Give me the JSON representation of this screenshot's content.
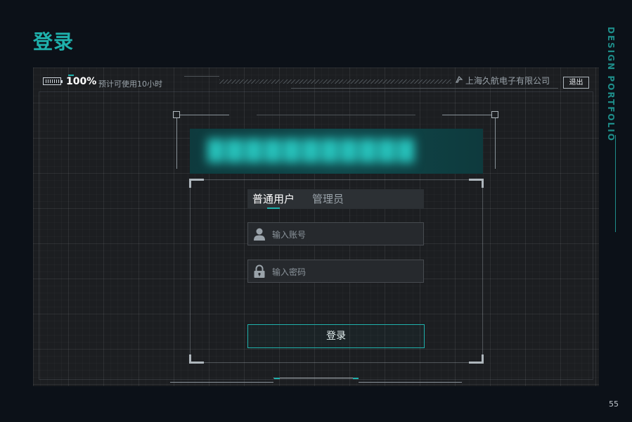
{
  "page": {
    "title": "登录",
    "side_label": "DESIGN PORTFOLIO",
    "page_number": "55"
  },
  "status_bar": {
    "battery_icon": "battery-icon",
    "battery_percent": "100%",
    "usage_text": "预计可使用10小时",
    "company_icon": "company-logo-icon",
    "company_name": "上海久航电子有限公司",
    "logout_label": "退出"
  },
  "banner": {
    "blurred_title": "███████████"
  },
  "login": {
    "tabs": [
      {
        "label": "普通用户",
        "active": true
      },
      {
        "label": "管理员",
        "active": false
      }
    ],
    "account": {
      "icon": "user-icon",
      "placeholder": "输入账号",
      "value": ""
    },
    "password": {
      "icon": "lock-icon",
      "placeholder": "输入密码",
      "value": ""
    },
    "submit_label": "登录"
  },
  "colors": {
    "accent": "#1fb1ac",
    "background": "#0c1118",
    "screen": "#1c1e21"
  }
}
